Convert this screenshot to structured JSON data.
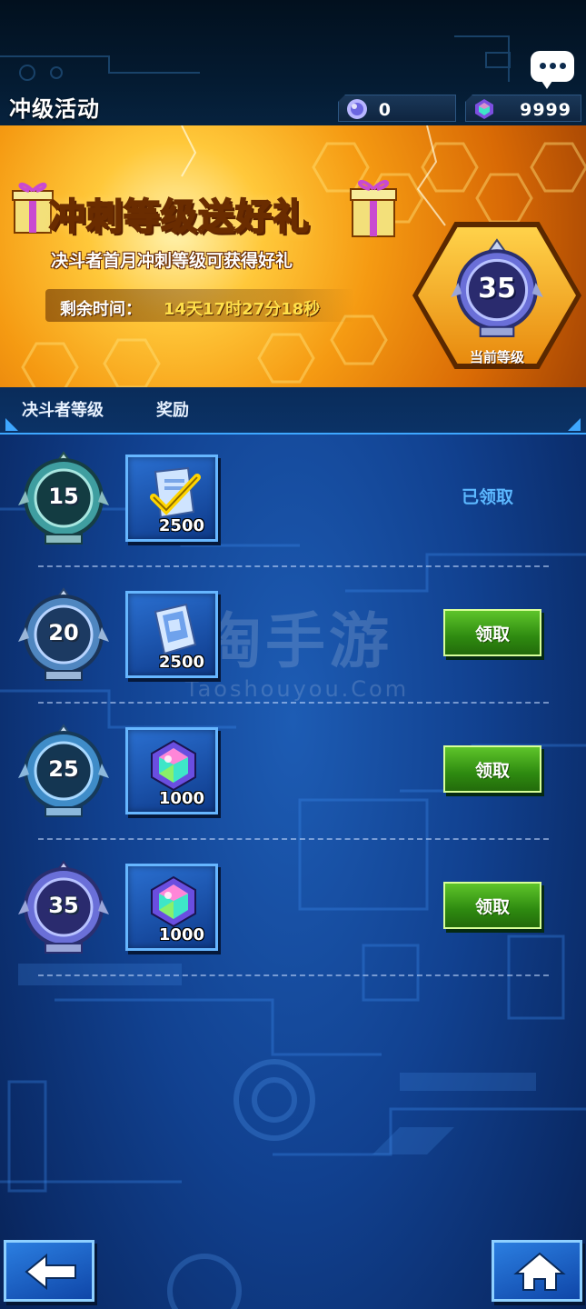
{
  "header": {
    "title": "冲级活动",
    "currencies": [
      {
        "icon": "orb-icon",
        "value": "0"
      },
      {
        "icon": "gem-icon",
        "value": "9999"
      }
    ],
    "chat_icon": "chat-bubble-icon"
  },
  "banner": {
    "headline": "冲刺等级送好礼",
    "subtitle": "决斗者首月冲刺等级可获得好礼",
    "timer_label": "剩余时间：",
    "timer_value": "14天17时27分18秒",
    "current_level": "35",
    "current_level_caption": "当前等级"
  },
  "table": {
    "col_level": "决斗者等级",
    "col_reward": "奖励"
  },
  "rows": [
    {
      "level": "15",
      "reward_icon": "ticket-check-icon",
      "quantity": "2500",
      "status": "已领取",
      "action": ""
    },
    {
      "level": "20",
      "reward_icon": "ticket-card-icon",
      "quantity": "2500",
      "status": "",
      "action": "领取"
    },
    {
      "level": "25",
      "reward_icon": "gem-icon",
      "quantity": "1000",
      "status": "",
      "action": "领取"
    },
    {
      "level": "35",
      "reward_icon": "gem-icon",
      "quantity": "1000",
      "status": "",
      "action": "领取"
    }
  ],
  "watermark": {
    "line1": "淘手游",
    "line2": "Taoshouyou.Com"
  },
  "footer": {
    "back_icon": "back-arrow-icon",
    "home_icon": "home-icon"
  }
}
